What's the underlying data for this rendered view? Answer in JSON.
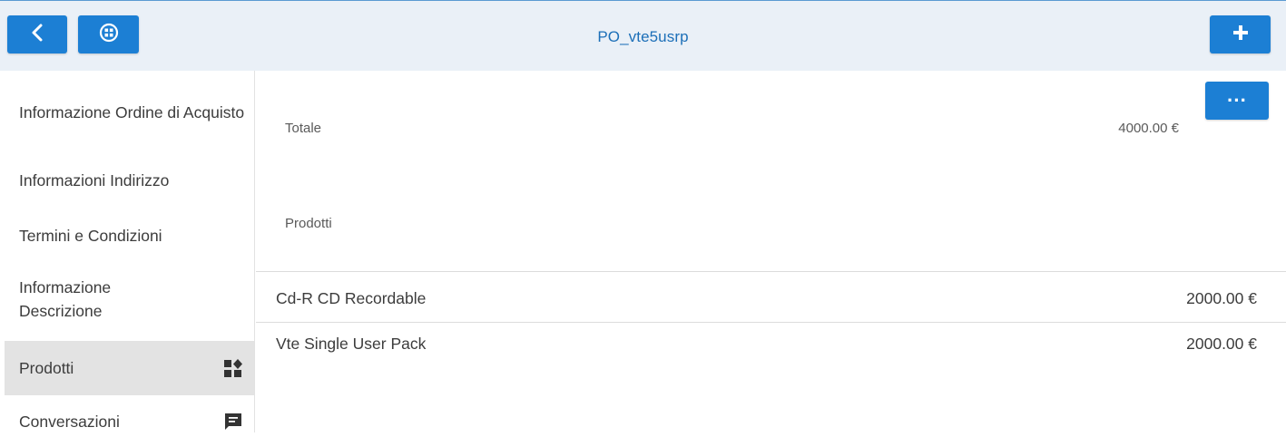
{
  "header": {
    "title": "PO_vte5usrp",
    "back_icon": "chevron-left-icon",
    "menu_icon": "grid-circle-icon",
    "add_icon": "plus-icon",
    "accent_color": "#1c7fd4"
  },
  "sidebar": {
    "items": [
      {
        "label": "Informazione Ordine di Acquisto"
      },
      {
        "label": "Informazioni Indirizzo"
      },
      {
        "label": "Termini e Condizioni"
      },
      {
        "label": "Informazione Descrizione"
      },
      {
        "label": "Prodotti",
        "icon": "products-icon",
        "active": true
      },
      {
        "label": "Conversazioni",
        "icon": "comment-icon"
      }
    ]
  },
  "main": {
    "more_label": "···",
    "fields": [
      {
        "label": "Totale",
        "value": "4000.00 €"
      },
      {
        "label": "Prodotti"
      }
    ],
    "products": [
      {
        "name": "Cd-R CD Recordable",
        "price": "2000.00 €"
      },
      {
        "name": "Vte Single User Pack",
        "price": "2000.00 €"
      }
    ]
  }
}
